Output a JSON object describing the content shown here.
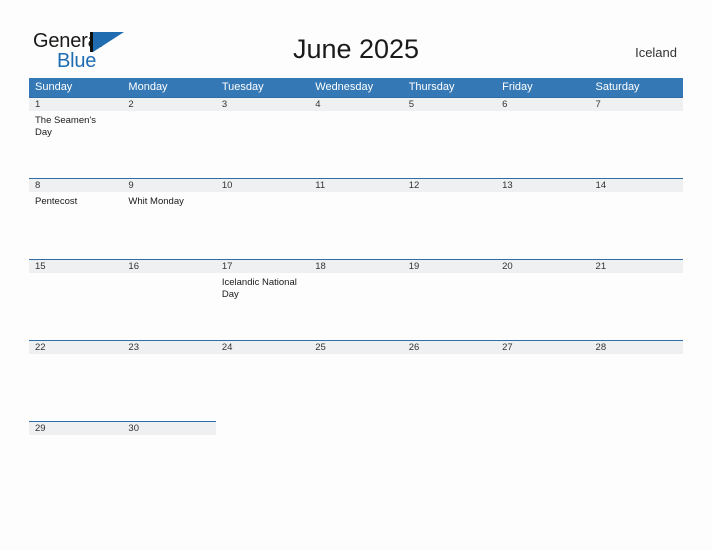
{
  "logo": {
    "word_one": "General",
    "word_two": "Blue",
    "triangle_icon": "triangle-logo-icon",
    "accent_color": "#1f6cb0"
  },
  "header": {
    "title": "June 2025",
    "country": "Iceland"
  },
  "theme": {
    "header_blue": "#3478b5",
    "band_gray": "#eef0f1",
    "rule_blue": "#2e6ea6",
    "page_background": "#fdfdfd",
    "text": "#222222"
  },
  "calendar": {
    "weekday_headers": [
      "Sunday",
      "Monday",
      "Tuesday",
      "Wednesday",
      "Thursday",
      "Friday",
      "Saturday"
    ],
    "weeks": [
      [
        {
          "day": "1",
          "events": [
            "The Seamen's Day"
          ]
        },
        {
          "day": "2",
          "events": []
        },
        {
          "day": "3",
          "events": []
        },
        {
          "day": "4",
          "events": []
        },
        {
          "day": "5",
          "events": []
        },
        {
          "day": "6",
          "events": []
        },
        {
          "day": "7",
          "events": []
        }
      ],
      [
        {
          "day": "8",
          "events": [
            "Pentecost"
          ]
        },
        {
          "day": "9",
          "events": [
            "Whit Monday"
          ]
        },
        {
          "day": "10",
          "events": []
        },
        {
          "day": "11",
          "events": []
        },
        {
          "day": "12",
          "events": []
        },
        {
          "day": "13",
          "events": []
        },
        {
          "day": "14",
          "events": []
        }
      ],
      [
        {
          "day": "15",
          "events": []
        },
        {
          "day": "16",
          "events": []
        },
        {
          "day": "17",
          "events": [
            "Icelandic National Day"
          ]
        },
        {
          "day": "18",
          "events": []
        },
        {
          "day": "19",
          "events": []
        },
        {
          "day": "20",
          "events": []
        },
        {
          "day": "21",
          "events": []
        }
      ],
      [
        {
          "day": "22",
          "events": []
        },
        {
          "day": "23",
          "events": []
        },
        {
          "day": "24",
          "events": []
        },
        {
          "day": "25",
          "events": []
        },
        {
          "day": "26",
          "events": []
        },
        {
          "day": "27",
          "events": []
        },
        {
          "day": "28",
          "events": []
        }
      ],
      [
        {
          "day": "29",
          "events": []
        },
        {
          "day": "30",
          "events": []
        },
        {
          "day": "",
          "events": []
        },
        {
          "day": "",
          "events": []
        },
        {
          "day": "",
          "events": []
        },
        {
          "day": "",
          "events": []
        },
        {
          "day": "",
          "events": []
        }
      ]
    ]
  }
}
